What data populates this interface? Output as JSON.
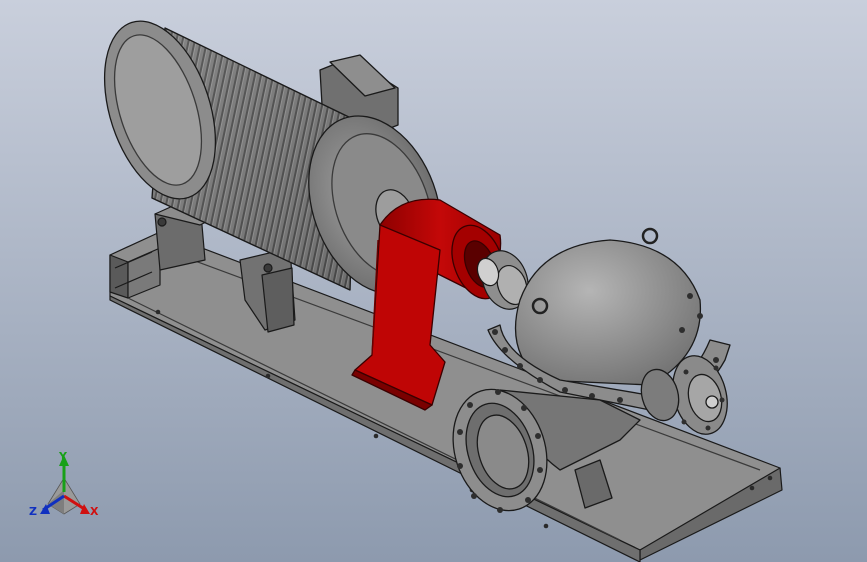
{
  "viewport": {
    "background_top": "#c9cfdc",
    "background_bottom": "#8d9aae"
  },
  "model": {
    "parts": [
      "motor-icon",
      "coupling-guard-icon",
      "pump-casing-icon",
      "baseplate-icon"
    ],
    "colors": {
      "body": "#8a8a8a",
      "body_light": "#a9a9a9",
      "body_dark": "#5c5c5c",
      "edge": "#1a1a1a",
      "guard": "#b50000",
      "guard_dark": "#7a0000",
      "guard_light": "#d81010"
    }
  },
  "triad": {
    "x_label": "X",
    "y_label": "Y",
    "z_label": "Z",
    "x_color": "#d01010",
    "y_color": "#18a018",
    "z_color": "#1030c0"
  }
}
